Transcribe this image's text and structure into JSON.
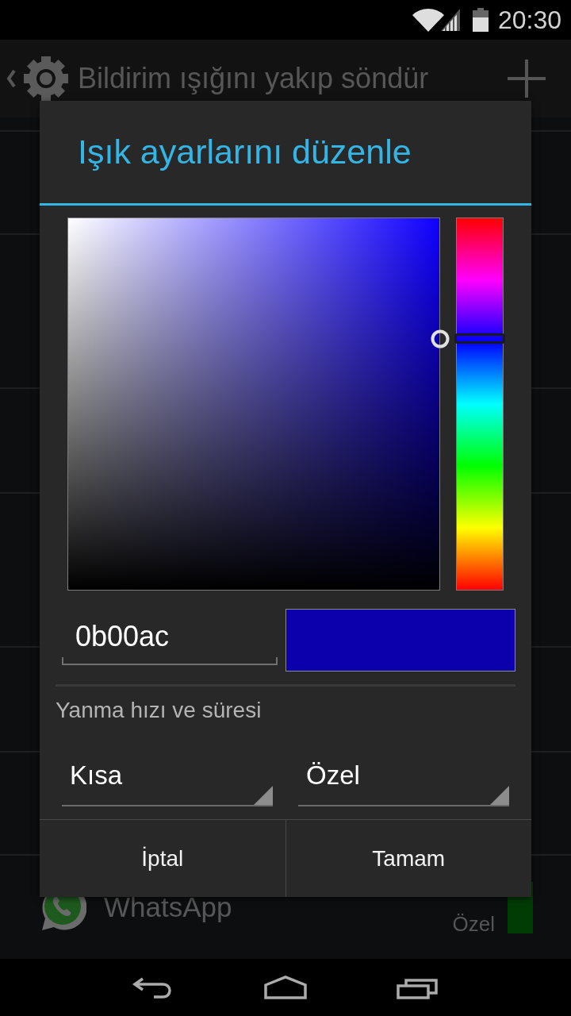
{
  "status_bar": {
    "time": "20:30"
  },
  "app_bar": {
    "title": "Bildirim ışığını yakıp söndür"
  },
  "apps": [
    {
      "name": "WhatsApp",
      "mode": "Özel",
      "color": "#023c05"
    }
  ],
  "dialog": {
    "title": "Işık ayarlarını düzenle",
    "color_picker": {
      "color": "#0b00ac"
    },
    "hue_slider": {
      "level": 0.677
    },
    "hex_field": {
      "value": "0b00ac"
    },
    "section_label": "Yanma hızı ve süresi",
    "spinners": [
      {
        "value": "Kısa"
      },
      {
        "value": "Özel"
      }
    ],
    "buttons": [
      "İptal",
      "Tamam"
    ]
  }
}
